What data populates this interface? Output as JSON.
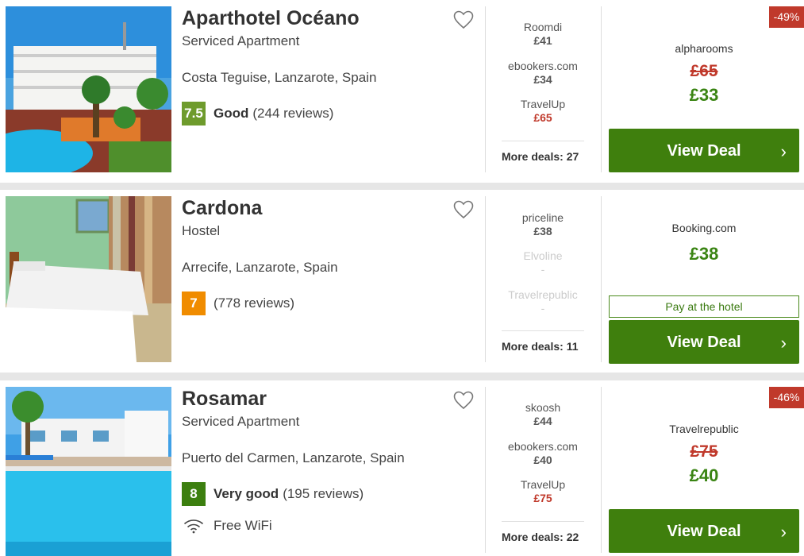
{
  "hotels": [
    {
      "name": "Aparthotel Océano",
      "type": "Serviced Apartment",
      "location": "Costa Teguise, Lanzarote, Spain",
      "score": "7.5",
      "score_color": "#6e9b2c",
      "rating_label": "Good",
      "reviews": "(244 reviews)",
      "deals": [
        {
          "provider": "Roomdi",
          "price": "£41"
        },
        {
          "provider": "ebookers.com",
          "price": "£34"
        },
        {
          "provider": "TravelUp",
          "price": "£65"
        }
      ],
      "more_deals": "More deals: 27",
      "discount": "-49%",
      "best_provider": "alpharooms",
      "old_price": "£65",
      "price": "£33",
      "button": "View Deal"
    },
    {
      "name": "Cardona",
      "type": "Hostel",
      "location": "Arrecife, Lanzarote, Spain",
      "score": "7",
      "score_color": "#f08c00",
      "rating_label": "",
      "reviews": "(778 reviews)",
      "deals": [
        {
          "provider": "priceline",
          "price": "£38"
        },
        {
          "provider": "Elvoline",
          "price": "-"
        },
        {
          "provider": "Travelrepublic",
          "price": "-"
        }
      ],
      "more_deals": "More deals: 11",
      "best_provider": "Booking.com",
      "price": "£38",
      "pay_at_hotel": "Pay at the hotel",
      "button": "View Deal"
    },
    {
      "name": "Rosamar",
      "type": "Serviced Apartment",
      "location": "Puerto del Carmen, Lanzarote, Spain",
      "score": "8",
      "score_color": "#3c7f0f",
      "rating_label": "Very good",
      "reviews": "(195 reviews)",
      "amenity": "Free WiFi",
      "deals": [
        {
          "provider": "skoosh",
          "price": "£44"
        },
        {
          "provider": "ebookers.com",
          "price": "£40"
        },
        {
          "provider": "TravelUp",
          "price": "£75"
        }
      ],
      "more_deals": "More deals: 22",
      "discount": "-46%",
      "best_provider": "Travelrepublic",
      "old_price": "£75",
      "price": "£40",
      "button": "View Deal"
    }
  ],
  "icons": {
    "favorite": "heart-outline-icon",
    "arrow": "chevron-right-icon",
    "wifi": "wifi-icon"
  }
}
